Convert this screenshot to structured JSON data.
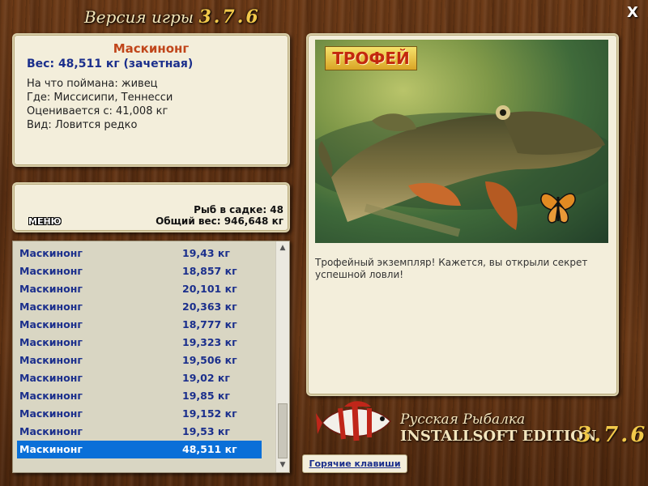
{
  "window": {
    "title_prefix": "Версия игры",
    "version": "3.7.6",
    "close_glyph": "X"
  },
  "fish_info": {
    "name": "Маскинонг",
    "weight": "Вес: 48,511 кг (зачетная)",
    "bait": "На что поймана: живец",
    "location": "Где: Миссисипи, Теннесси",
    "min_weight": "Оценивается с: 41,008 кг",
    "rarity": "Вид: Ловится редко"
  },
  "stats": {
    "menu_label": "МЕНЮ",
    "fish_count": "Рыб в садке: 48",
    "total_weight": "Общий вес: 946,648 кг"
  },
  "catch_list": {
    "rows": [
      {
        "name": "Маскинонг",
        "weight": "19,43 кг"
      },
      {
        "name": "Маскинонг",
        "weight": "18,857 кг"
      },
      {
        "name": "Маскинонг",
        "weight": "20,101 кг"
      },
      {
        "name": "Маскинонг",
        "weight": "20,363 кг"
      },
      {
        "name": "Маскинонг",
        "weight": "18,777 кг"
      },
      {
        "name": "Маскинонг",
        "weight": "19,323 кг"
      },
      {
        "name": "Маскинонг",
        "weight": "19,506 кг"
      },
      {
        "name": "Маскинонг",
        "weight": "19,02 кг"
      },
      {
        "name": "Маскинонг",
        "weight": "19,85 кг"
      },
      {
        "name": "Маскинонг",
        "weight": "19,152 кг"
      },
      {
        "name": "Маскинонг",
        "weight": "19,53 кг"
      },
      {
        "name": "Маскинонг",
        "weight": "48,511 кг"
      }
    ],
    "selected_index": 11
  },
  "trophy": {
    "badge": "ТРОФЕЙ",
    "description": "Трофейный экземпляр! Кажется, вы открыли секрет успешной ловли!"
  },
  "brand": {
    "line1": "Русская Рыбалка",
    "line2": "INSTALLSOFT EDITION",
    "version": "3.7.6"
  },
  "hotkeys_label": "Горячие клавиши",
  "colors": {
    "fish_name": "#c0451a",
    "weight_text": "#1b2f8c",
    "selection": "#0a6fd8",
    "panel_bg": "#f3eedb"
  }
}
